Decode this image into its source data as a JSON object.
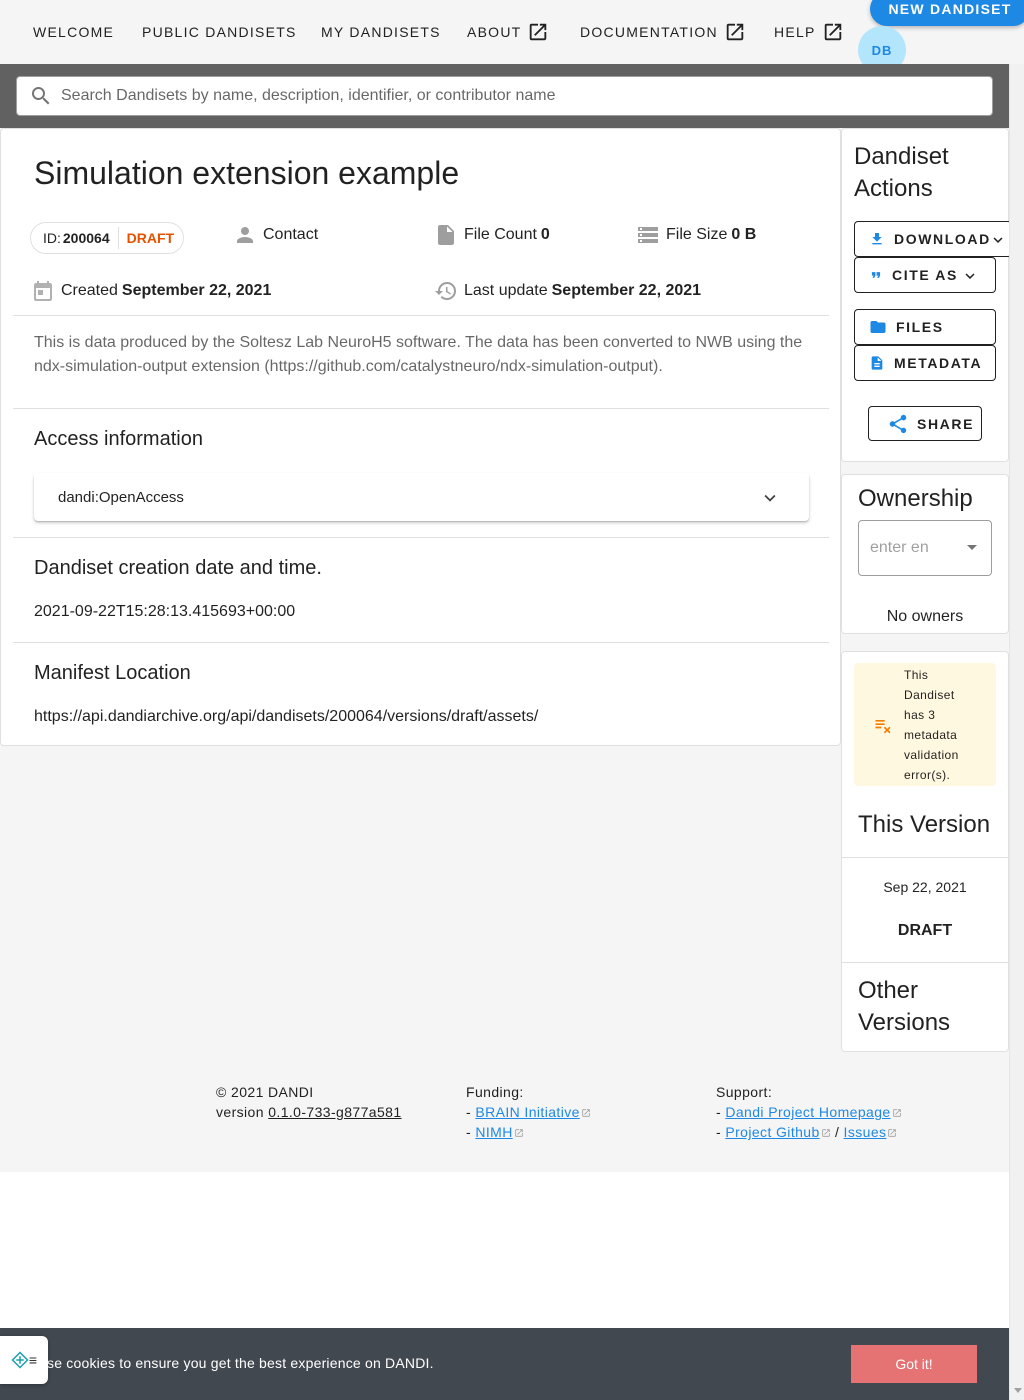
{
  "nav": {
    "items": [
      {
        "label": "WELCOME"
      },
      {
        "label": "PUBLIC DANDISETS"
      },
      {
        "label": "MY DANDISETS"
      },
      {
        "label": "ABOUT"
      },
      {
        "label": "DOCUMENTATION"
      },
      {
        "label": "HELP"
      }
    ],
    "new_button": "NEW DANDISET",
    "avatar": "DB"
  },
  "search": {
    "placeholder": "Search Dandisets by name, description, identifier, or contributor name"
  },
  "dandiset": {
    "title": "Simulation extension example",
    "id_label": "ID:",
    "id": "200064",
    "status": "DRAFT",
    "contact_label": "Contact",
    "file_count_label": "File Count",
    "file_count": "0",
    "file_size_label": "File Size",
    "file_size": "0 B",
    "created_label": "Created",
    "created": "September 22, 2021",
    "updated_label": "Last update",
    "updated": "September 22, 2021",
    "description": "This is data produced by the Soltesz Lab NeuroH5 software. The data has been converted to NWB using the ndx-simulation-output extension (https://github.com/catalystneuro/ndx-simulation-output).",
    "access_heading": "Access information",
    "access_value": "dandi:OpenAccess",
    "creation_heading": "Dandiset creation date and time.",
    "creation_value": "2021-09-22T15:28:13.415693+00:00",
    "manifest_heading": "Manifest Location",
    "manifest_value": "https://api.dandiarchive.org/api/dandisets/200064/versions/draft/assets/"
  },
  "actions": {
    "title": "Dandiset Actions",
    "download": "DOWNLOAD",
    "cite": "CITE AS",
    "files": "FILES",
    "metadata": "METADATA",
    "share": "SHARE"
  },
  "ownership": {
    "title": "Ownership",
    "placeholder": "enter en",
    "empty": "No owners"
  },
  "validation": {
    "message": "This Dandiset has 3 metadata validation error(s)."
  },
  "versions": {
    "this_title": "This Version",
    "date": "Sep 22, 2021",
    "label": "DRAFT",
    "other_title": "Other Versions"
  },
  "footer": {
    "copyright": "© 2021 DANDI",
    "version_label": "version",
    "version": "0.1.0-733-g877a581",
    "funding_label": "Funding:",
    "funding_links": [
      "BRAIN Initiative",
      "NIMH"
    ],
    "support_label": "Support:",
    "support_links": [
      "Dandi Project Homepage",
      "Project Github",
      "Issues"
    ]
  },
  "cookie": {
    "text": "se cookies to ensure you get the best experience on DANDI.",
    "button": "Got it!"
  },
  "colors": {
    "primary": "#1e88e5",
    "draft": "#e65100",
    "warning_bg": "#fff8e1",
    "warning_icon": "#f57c00",
    "cookie_bar": "#424850",
    "cookie_button": "#e57373"
  }
}
